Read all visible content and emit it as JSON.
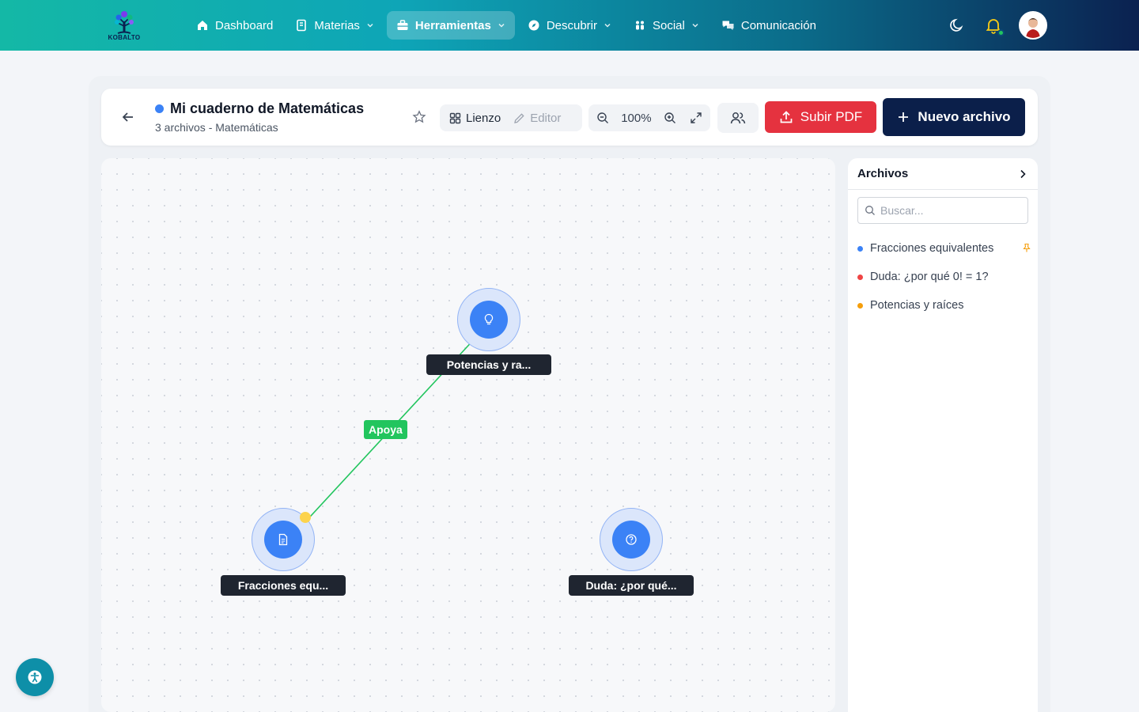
{
  "app": {
    "logo_text": "KOBALTO"
  },
  "nav": {
    "items": [
      {
        "label": "Dashboard",
        "icon": "home-icon",
        "dropdown": false,
        "active": false
      },
      {
        "label": "Materias",
        "icon": "book-icon",
        "dropdown": true,
        "active": false
      },
      {
        "label": "Herramientas",
        "icon": "toolbox-icon",
        "dropdown": true,
        "active": true
      },
      {
        "label": "Descubrir",
        "icon": "compass-icon",
        "dropdown": true,
        "active": false
      },
      {
        "label": "Social",
        "icon": "users-icon",
        "dropdown": true,
        "active": false
      },
      {
        "label": "Comunicación",
        "icon": "chat-icon",
        "dropdown": false,
        "active": false
      }
    ]
  },
  "notebook": {
    "title": "Mi cuaderno de Matemáticas",
    "file_count": "3 archivos",
    "separator": " - ",
    "subject": "Matemáticas",
    "dot_color": "#3b82f6"
  },
  "toolbar": {
    "view_canvas": "Lienzo",
    "view_editor": "Editor",
    "zoom": "100%",
    "upload_pdf": "Subir PDF",
    "new_file": "Nuevo archivo"
  },
  "canvas": {
    "nodes": [
      {
        "label": "Potencias y ra...",
        "icon": "lightbulb-icon"
      },
      {
        "label": "Fracciones equ...",
        "icon": "document-icon"
      },
      {
        "label": "Duda: ¿por qué...",
        "icon": "question-icon"
      }
    ],
    "edges": [
      {
        "label": "Apoya",
        "color": "#22c55e"
      }
    ]
  },
  "files_panel": {
    "title": "Archivos",
    "search_placeholder": "Buscar...",
    "files": [
      {
        "name": "Fracciones equivalentes",
        "color": "#3b82f6",
        "pinned": true
      },
      {
        "name": "Duda: ¿por qué 0! = 1?",
        "color": "#ef4444",
        "pinned": false
      },
      {
        "name": "Potencias y raíces",
        "color": "#f59e0b",
        "pinned": false
      }
    ]
  }
}
